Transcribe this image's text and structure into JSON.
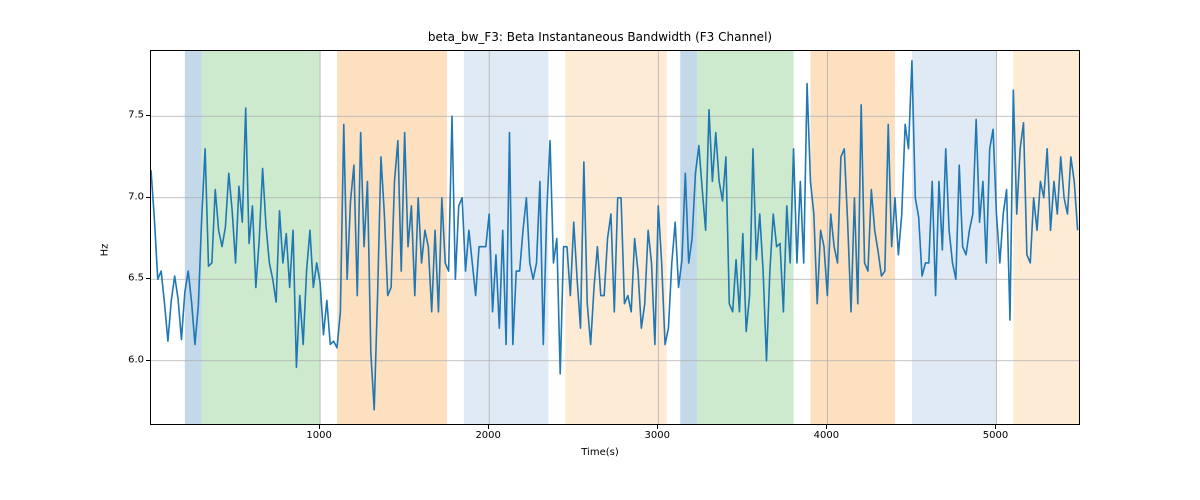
{
  "chart_data": {
    "type": "line",
    "title": "beta_bw_F3: Beta Instantaneous Bandwidth (F3 Channel)",
    "xlabel": "Time(s)",
    "ylabel": "Hz",
    "xlim": [
      0,
      5500
    ],
    "ylim": [
      5.6,
      7.9
    ],
    "xticks": [
      1000,
      2000,
      3000,
      4000,
      5000
    ],
    "yticks": [
      6.0,
      6.5,
      7.0,
      7.5
    ],
    "line_color": "#1f77b4",
    "bands": [
      {
        "x0": 200,
        "x1": 300,
        "color": "#a3c3dc",
        "alpha": 0.65
      },
      {
        "x0": 300,
        "x1": 1000,
        "color": "#a6d9a6",
        "alpha": 0.55
      },
      {
        "x0": 1100,
        "x1": 1750,
        "color": "#f9c78d",
        "alpha": 0.55
      },
      {
        "x0": 1850,
        "x1": 2350,
        "color": "#cfdff0",
        "alpha": 0.65
      },
      {
        "x0": 2450,
        "x1": 3050,
        "color": "#fde2c4",
        "alpha": 0.7
      },
      {
        "x0": 3130,
        "x1": 3230,
        "color": "#a3c3dc",
        "alpha": 0.65
      },
      {
        "x0": 3230,
        "x1": 3800,
        "color": "#a6d9a6",
        "alpha": 0.55
      },
      {
        "x0": 3900,
        "x1": 4400,
        "color": "#f9c78d",
        "alpha": 0.55
      },
      {
        "x0": 4500,
        "x1": 5000,
        "color": "#cfdff0",
        "alpha": 0.65
      },
      {
        "x0": 5100,
        "x1": 5500,
        "color": "#fde2c4",
        "alpha": 0.7
      }
    ],
    "series": [
      {
        "name": "beta_bw_F3",
        "x_step": 20,
        "y": [
          7.17,
          6.87,
          6.5,
          6.55,
          6.35,
          6.12,
          6.37,
          6.52,
          6.38,
          6.13,
          6.42,
          6.55,
          6.36,
          6.1,
          6.34,
          6.88,
          7.3,
          6.58,
          6.6,
          7.05,
          6.8,
          6.7,
          6.82,
          7.15,
          6.92,
          6.6,
          7.07,
          6.85,
          7.55,
          6.72,
          6.95,
          6.45,
          6.74,
          7.18,
          6.83,
          6.6,
          6.5,
          6.36,
          6.92,
          6.6,
          6.78,
          6.45,
          6.8,
          5.96,
          6.4,
          6.1,
          6.55,
          6.8,
          6.45,
          6.6,
          6.48,
          6.16,
          6.37,
          6.1,
          6.12,
          6.08,
          6.3,
          7.45,
          6.5,
          6.98,
          7.2,
          6.4,
          7.4,
          6.7,
          7.1,
          6.05,
          5.7,
          6.4,
          7.25,
          6.9,
          6.4,
          6.45,
          7.1,
          7.35,
          6.55,
          7.4,
          6.7,
          6.95,
          6.4,
          7.0,
          6.6,
          6.8,
          6.7,
          6.3,
          6.8,
          6.3,
          7.0,
          6.6,
          6.55,
          7.5,
          6.5,
          6.95,
          7.0,
          6.55,
          6.8,
          6.6,
          6.4,
          6.7,
          6.7,
          6.7,
          6.9,
          6.3,
          6.65,
          6.2,
          6.8,
          6.1,
          7.4,
          6.1,
          6.55,
          6.55,
          6.8,
          7.0,
          6.6,
          6.5,
          6.6,
          7.1,
          6.1,
          6.9,
          7.35,
          6.6,
          6.75,
          5.92,
          6.7,
          6.7,
          6.4,
          6.85,
          6.5,
          6.2,
          7.22,
          6.35,
          6.1,
          6.45,
          6.7,
          6.4,
          6.4,
          6.75,
          6.9,
          6.3,
          7.0,
          7.0,
          6.35,
          6.4,
          6.3,
          6.75,
          6.55,
          6.2,
          6.35,
          6.8,
          6.6,
          6.1,
          6.95,
          6.6,
          6.1,
          6.2,
          6.6,
          6.85,
          6.45,
          6.62,
          7.15,
          6.6,
          6.75,
          7.15,
          7.32,
          7.05,
          6.8,
          7.54,
          7.1,
          7.4,
          7.1,
          6.98,
          7.25,
          6.35,
          6.3,
          6.62,
          6.3,
          6.78,
          6.18,
          6.4,
          7.3,
          6.62,
          6.9,
          6.55,
          6.0,
          6.55,
          6.9,
          6.7,
          6.72,
          6.3,
          6.95,
          6.6,
          7.3,
          6.6,
          7.1,
          6.6,
          7.7,
          7.1,
          6.9,
          6.35,
          6.8,
          6.7,
          6.4,
          6.9,
          6.7,
          6.6,
          7.25,
          7.3,
          6.85,
          6.3,
          7.0,
          6.35,
          7.57,
          6.6,
          6.55,
          7.05,
          6.8,
          6.67,
          6.52,
          6.55,
          7.45,
          6.7,
          7.0,
          6.65,
          6.9,
          7.45,
          7.3,
          7.84,
          7.0,
          6.88,
          6.52,
          6.6,
          6.6,
          7.1,
          6.4,
          7.1,
          6.68,
          7.3,
          6.8,
          6.6,
          6.5,
          7.2,
          6.7,
          6.65,
          6.8,
          6.9,
          7.48,
          6.85,
          7.1,
          6.6,
          7.3,
          7.42,
          6.9,
          6.6,
          6.9,
          7.05,
          6.25,
          7.66,
          6.9,
          7.3,
          7.46,
          6.65,
          6.6,
          7.0,
          6.8,
          7.1,
          7.0,
          7.3,
          6.8,
          7.1,
          6.9,
          7.25,
          7.0,
          6.9,
          7.25,
          7.1,
          6.8
        ]
      }
    ]
  }
}
